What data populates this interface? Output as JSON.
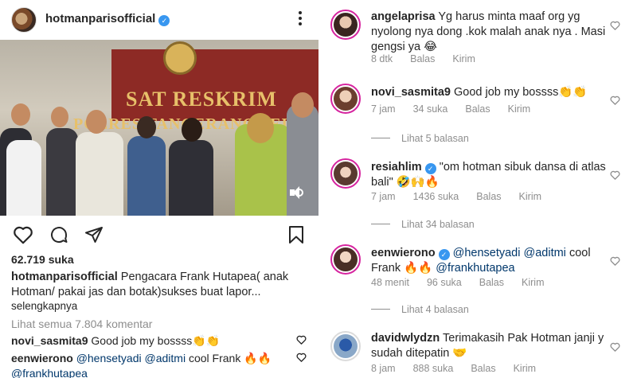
{
  "post": {
    "username": "hotmanparisofficial",
    "likes": "62.719 suka",
    "caption_user": "hotmanparisofficial",
    "caption_text": "Pengacara Frank Hutapea( anak Hotman/ pakai jas dan botak)sukses buat lapor...",
    "more_label": "selengkapnya",
    "view_all": "Lihat semua 7.804 komentar",
    "video_sign_line1": "SAT RESKRIM",
    "video_sign_line2": "POLRES TANGERANG SELA",
    "mini_comments": [
      {
        "user": "novi_sasmita9",
        "text": "Good job my bossss👏👏"
      },
      {
        "user": "eenwierono",
        "mention1": "@hensetyadi",
        "mention2": "@aditmi",
        "text_mid": "cool Frank 🔥🔥",
        "mention3": "@frankhutapea"
      }
    ]
  },
  "comments": [
    {
      "user": "angelaprisa",
      "verified": false,
      "text": "Yg harus minta maaf org yg nyolong nya dong .kok malah anak nya . Masi gengsi ya 😂",
      "time": "8 dtk",
      "likes": "",
      "reply": "Balas",
      "send": "Kirim"
    },
    {
      "user": "novi_sasmita9",
      "verified": false,
      "text": "Good job my bossss👏👏",
      "time": "7 jam",
      "likes": "34 suka",
      "reply": "Balas",
      "send": "Kirim",
      "replies_label": "Lihat 5 balasan"
    },
    {
      "user": "resiahlim",
      "verified": true,
      "text": "\"om hotman sibuk dansa di atlas bali\" 🤣🙌🔥",
      "time": "7 jam",
      "likes": "1436 suka",
      "reply": "Balas",
      "send": "Kirim",
      "replies_label": "Lihat 34 balasan"
    },
    {
      "user": "eenwierono",
      "verified": true,
      "mention1": "@hensetyadi",
      "mention2": "@aditmi",
      "text_mid": "cool Frank 🔥🔥",
      "mention3": "@frankhutapea",
      "time": "48 menit",
      "likes": "96 suka",
      "reply": "Balas",
      "send": "Kirim",
      "replies_label": "Lihat 4 balasan"
    },
    {
      "user": "davidwlydzn",
      "verified": false,
      "text": "Terimakasih Pak Hotman janji y sudah ditepatin 🤝",
      "time": "8 jam",
      "likes": "888 suka",
      "reply": "Balas",
      "send": "Kirim"
    }
  ],
  "colors": {
    "verified": "#3897f0",
    "meta": "#8e8e8e",
    "mention": "#00376b",
    "text": "#262626"
  },
  "icons": [
    "more-icon",
    "heart-icon",
    "comment-icon",
    "share-icon",
    "bookmark-icon",
    "mute-icon",
    "verified-icon"
  ]
}
